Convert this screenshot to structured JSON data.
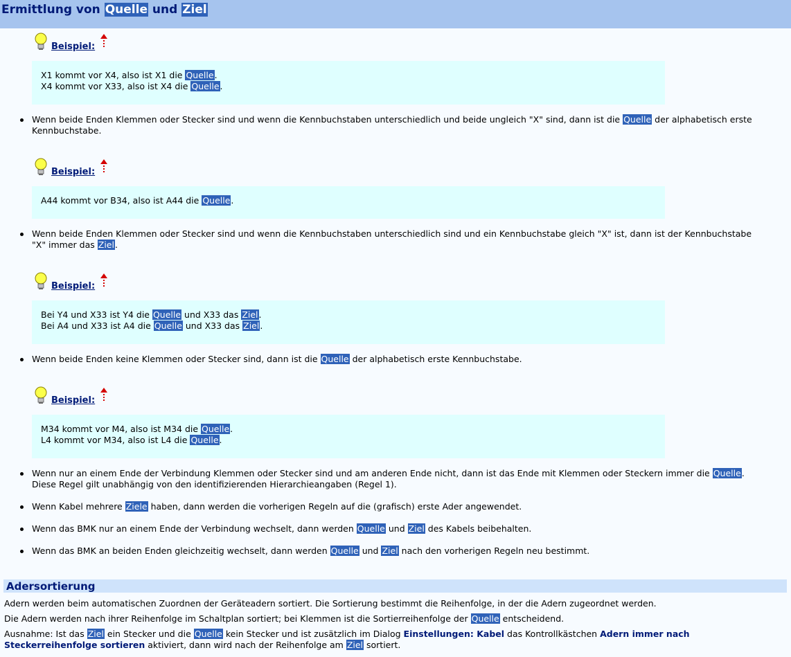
{
  "header": {
    "prefix": "Ermittlung von ",
    "quelle": "Quelle",
    "und": " und ",
    "ziel": "Ziel"
  },
  "example_label": "Beispiel:",
  "icons": {
    "bulb": "lightbulb-icon",
    "up": "up-arrow-icon"
  },
  "colors": {
    "highlight": "#2f62b8",
    "header_bg": "#a6c4ee",
    "example_bg": "#dfffff",
    "heading": "#001a77"
  },
  "ex1": {
    "l1a": "X1 kommt vor X4, also ist X1 die ",
    "l1b": "Quelle",
    "l1c": ".",
    "l2a": "X4 kommt vor X33, also ist X4 die ",
    "l2b": "Quelle",
    "l2c": "."
  },
  "b1": {
    "a": "Wenn beide Enden Klemmen oder Stecker sind und wenn die Kennbuchstaben unterschiedlich und beide ungleich \"X\" sind, dann ist die ",
    "b": "Quelle",
    "c": " der alphabetisch erste",
    "d": "Kennbuchstabe."
  },
  "ex2": {
    "a": "A44 kommt vor B34, also ist A44 die ",
    "b": "Quelle",
    "c": "."
  },
  "b2": {
    "a": "Wenn beide Enden Klemmen oder Stecker sind und wenn die Kennbuchstaben unterschiedlich sind und ein Kennbuchstabe gleich \"X\" ist, dann ist der Kennbuchstabe",
    "b": "\"X\" immer das ",
    "c": "Ziel",
    "d": "."
  },
  "ex3": {
    "l1a": "Bei Y4 und X33 ist Y4 die ",
    "l1b": "Quelle",
    "l1c": " und X33 das ",
    "l1d": "Ziel",
    "l1e": ".",
    "l2a": "Bei A4 und X33 ist A4 die ",
    "l2b": "Quelle",
    "l2c": " und X33 das ",
    "l2d": "Ziel",
    "l2e": "."
  },
  "b3": {
    "a": "Wenn beide Enden keine Klemmen oder Stecker sind, dann ist die ",
    "b": "Quelle",
    "c": " der alphabetisch erste Kennbuchstabe."
  },
  "ex4": {
    "l1a": "M34 kommt vor M4, also ist M34 die ",
    "l1b": "Quelle",
    "l1c": ".",
    "l2a": "L4 kommt vor M34, also ist L4 die ",
    "l2b": "Quelle",
    "l2c": "."
  },
  "b4": {
    "a": "Wenn nur an einem Ende der Verbindung Klemmen oder Stecker sind und am anderen Ende nicht, dann ist das Ende mit Klemmen oder Steckern immer die ",
    "b": "Quelle",
    "c": ".",
    "d": "Diese Regel gilt unabhängig von den identifizierenden Hierarchieangaben (Regel 1)."
  },
  "b5": {
    "a": "Wenn Kabel mehrere ",
    "b": "Ziele",
    "c": " haben, dann werden die vorherigen Regeln auf die (grafisch) erste Ader angewendet."
  },
  "b6": {
    "a": "Wenn das BMK nur an einem Ende der Verbindung wechselt, dann werden ",
    "b": "Quelle",
    "c": " und ",
    "d": "Ziel",
    "e": " des Kabels beibehalten."
  },
  "b7": {
    "a": "Wenn das BMK an beiden Enden gleichzeitig wechselt, dann werden ",
    "b": "Quelle",
    "c": " und ",
    "d": "Ziel",
    "e": " nach den vorherigen Regeln neu bestimmt."
  },
  "section2": {
    "title": "Adersortierung"
  },
  "p1": "Adern werden beim automatischen Zuordnen der Geräteadern sortiert. Die Sortierung bestimmt die Reihenfolge, in der die Adern zugeordnet werden.",
  "p2": {
    "a": "Die Adern werden nach ihrer Reihenfolge im Schaltplan sortiert; bei Klemmen ist die Sortierreihenfolge der ",
    "b": "Quelle",
    "c": " entscheidend."
  },
  "p3": {
    "a": "Ausnahme: Ist das ",
    "b": "Ziel",
    "c": " ein Stecker und die ",
    "d": "Quelle",
    "e": " kein Stecker und ist zusätzlich im Dialog ",
    "f": "Einstellungen: Kabel",
    "g": " das Kontrollkästchen ",
    "h": "Adern immer nach",
    "i": "Steckerreihenfolge sortieren",
    "j": " aktiviert, dann wird nach der Reihenfolge am ",
    "k": "Ziel",
    "l": " sortiert."
  }
}
